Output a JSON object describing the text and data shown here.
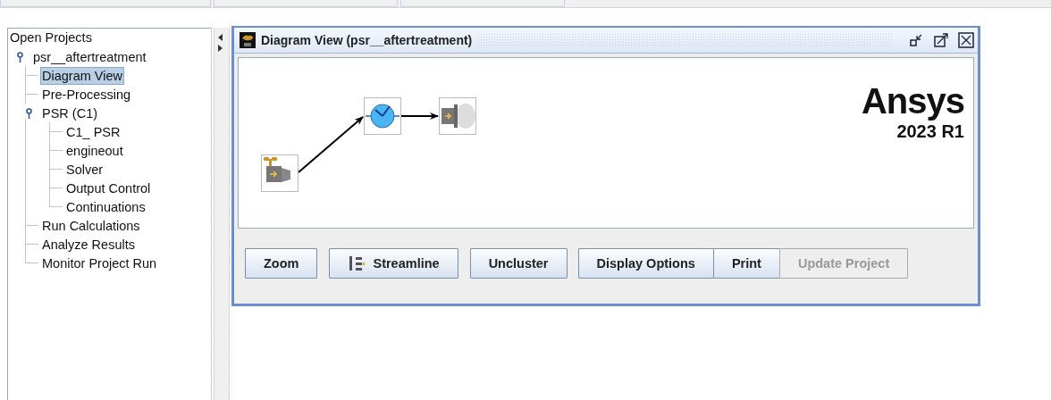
{
  "tree": {
    "root": "Open Projects",
    "items": [
      {
        "label": "psr__aftertreatment",
        "selected": false,
        "expanded": true,
        "children": [
          {
            "label": "Diagram View",
            "selected": true
          },
          {
            "label": "Pre-Processing",
            "selected": false
          },
          {
            "label": "PSR (C1)",
            "selected": false,
            "expanded": true,
            "children": [
              {
                "label": "C1_ PSR",
                "selected": false
              },
              {
                "label": "engineout",
                "selected": false
              },
              {
                "label": "Solver",
                "selected": false
              },
              {
                "label": "Output Control",
                "selected": false
              },
              {
                "label": "Continuations",
                "selected": false
              }
            ]
          },
          {
            "label": "Run Calculations",
            "selected": false
          },
          {
            "label": "Analyze Results",
            "selected": false
          },
          {
            "label": "Monitor Project Run",
            "selected": false
          }
        ]
      }
    ]
  },
  "diagram_window": {
    "title": "Diagram View  (psr__aftertreatment)",
    "nodes": [
      {
        "kind": "inlet"
      },
      {
        "kind": "reactor"
      },
      {
        "kind": "outlet"
      }
    ],
    "logo": {
      "name": "Ansys",
      "version": "2023 R1"
    },
    "buttons": [
      {
        "label": "Zoom",
        "disabled": false
      },
      {
        "label": "Streamline",
        "disabled": false,
        "kind": "icon"
      },
      {
        "label": "Uncluster",
        "disabled": false
      },
      {
        "label": "Display Options",
        "disabled": false
      },
      {
        "label": "Print",
        "disabled": false
      },
      {
        "label": "Update Project",
        "disabled": true
      }
    ]
  }
}
